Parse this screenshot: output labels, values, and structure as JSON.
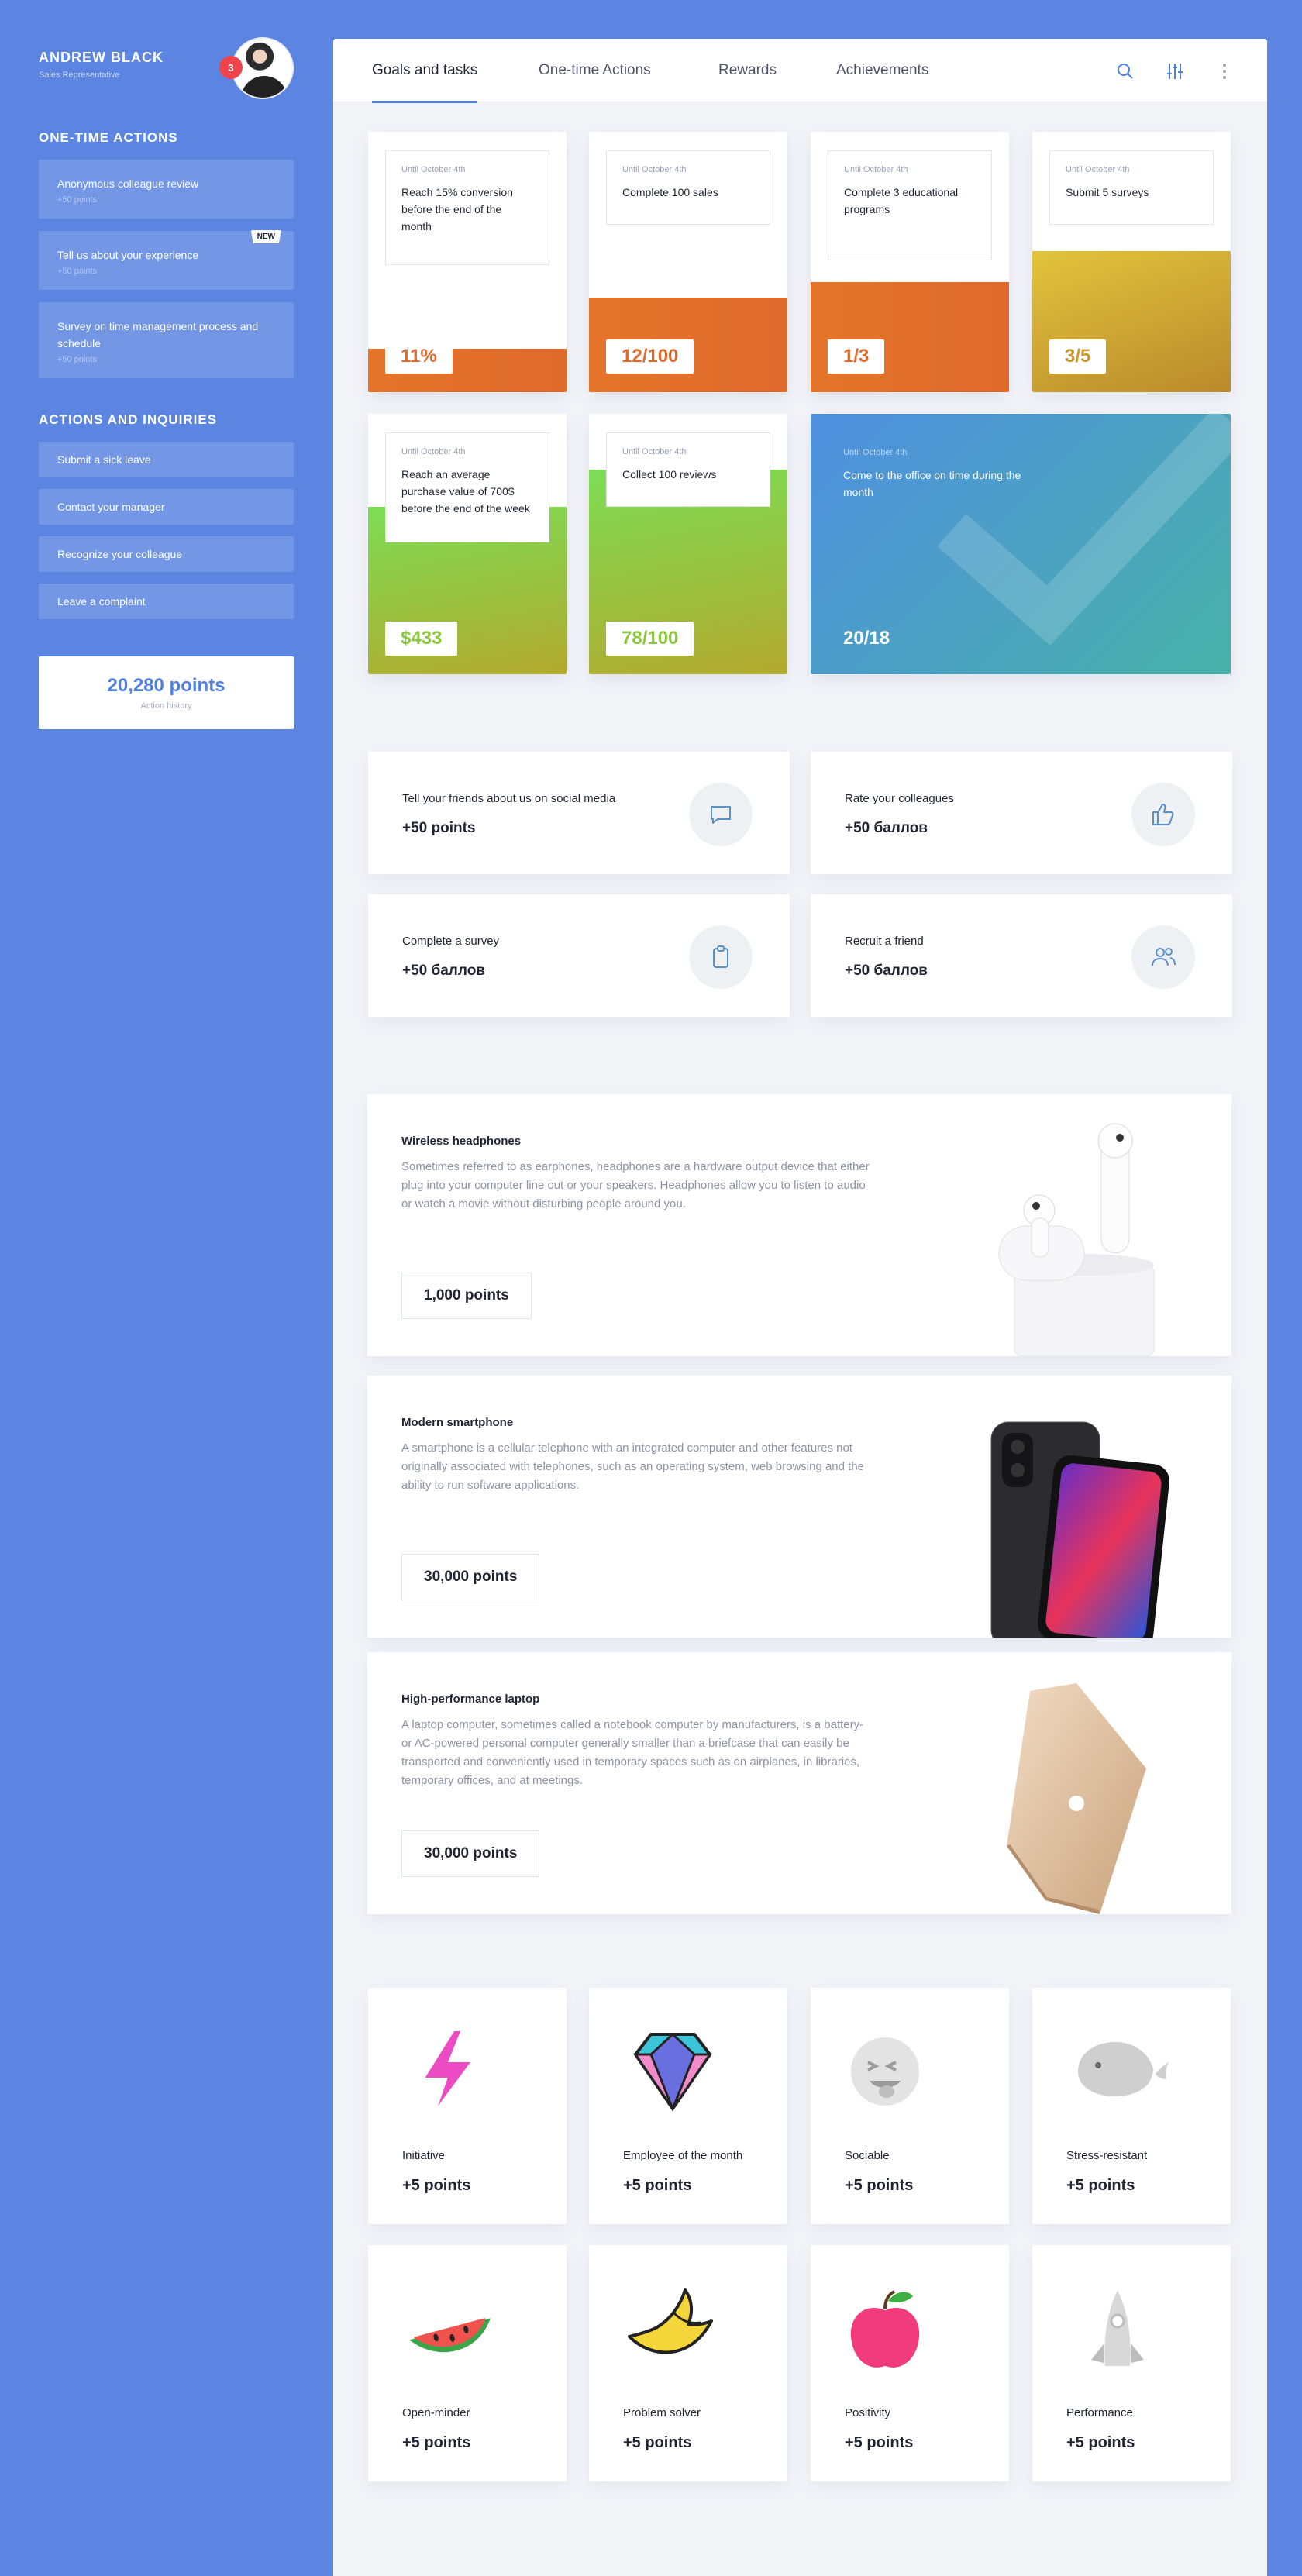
{
  "profile": {
    "name": "ANDREW BLACK",
    "role": "Sales Representative",
    "notifications": "3"
  },
  "sidebar": {
    "one_time_title": "ONE-TIME ACTIONS",
    "one_time_items": [
      {
        "title": "Anonymous colleague review",
        "points": "+50 points"
      },
      {
        "title": "Tell us about your experience",
        "points": "+50 points",
        "badge": "NEW"
      },
      {
        "title": "Survey on time management process and schedule",
        "points": "+50 points"
      }
    ],
    "inquiries_title": "ACTIONS AND INQUIRIES",
    "inquiries": [
      "Submit a sick leave",
      "Contact your manager",
      "Recognize your colleague",
      "Leave a complaint"
    ],
    "points_total": "20,280 points",
    "action_history": "Action history"
  },
  "tabs": [
    "Goals and tasks",
    "One-time Actions",
    "Rewards",
    "Achievements"
  ],
  "tools": {
    "search": "search-icon",
    "filter": "sliders-icon",
    "more": "more-vertical-icon"
  },
  "goals": [
    {
      "until": "Until October 4th",
      "task": "Reach 15% conversion before the end of the month",
      "value": "11%",
      "progress": 0.11,
      "color": "#e06a2c"
    },
    {
      "until": "Until October 4th",
      "task": "Complete 100 sales",
      "value": "12/100",
      "progress": 0.12,
      "color": "#e06a2c"
    },
    {
      "until": "Until October 4th",
      "task": "Complete 3 educational programs",
      "value": "1/3",
      "progress": 0.33,
      "color": "#e06a2c"
    },
    {
      "until": "Until October 4th",
      "task": "Submit 5 surveys",
      "value": "3/5",
      "progress": 0.6,
      "color": "#c9972a"
    },
    {
      "until": "Until October 4th",
      "task": "Reach an average purchase value of 700$ before the end of the week",
      "value": "$433",
      "progress": 0.62,
      "color": "#8cc83c"
    },
    {
      "until": "Until October 4th",
      "task": "Collect 100 reviews",
      "value": "78/100",
      "progress": 0.78,
      "color": "#8cc83c"
    },
    {
      "until": "Until October 4th",
      "task": "Come to the office on time during the month",
      "value": "20/18",
      "progress": 1,
      "color": "#4a9ad6"
    }
  ],
  "actions": [
    {
      "title": "Tell your friends about us on social media",
      "points": "+50 points",
      "icon": "chat-icon"
    },
    {
      "title": "Rate your colleagues",
      "points": "+50 баллов",
      "icon": "thumbs-up-icon"
    },
    {
      "title": "Complete a survey",
      "points": "+50 баллов",
      "icon": "clipboard-icon"
    },
    {
      "title": "Recruit a friend",
      "points": "+50 баллов",
      "icon": "users-icon"
    }
  ],
  "rewards": [
    {
      "name": "Wireless headphones",
      "desc": "Sometimes referred to as earphones, headphones are a hardware output device that either plug into your computer line out or your speakers. Headphones allow you to listen to audio or watch a movie without disturbing people around you.",
      "price": "1,000 points",
      "image": "airpods-image"
    },
    {
      "name": "Modern smartphone",
      "desc": "A smartphone is a cellular telephone with an integrated computer and other features not originally associated with telephones, such as an operating system, web browsing and the ability to run software applications.",
      "price": "30,000 points",
      "image": "smartphone-image"
    },
    {
      "name": "High-performance laptop",
      "desc": "A laptop computer, sometimes called a notebook computer by manufacturers, is a battery- or AC-powered personal computer generally smaller than a briefcase that can easily be transported and conveniently used in temporary spaces such as on airplanes, in libraries, temporary offices, and at meetings.",
      "price": "30,000 points",
      "image": "laptop-image"
    }
  ],
  "achievements": [
    {
      "name": "Initiative",
      "points": "+5 points",
      "icon": "lightning-icon"
    },
    {
      "name": "Employee of the month",
      "points": "+5 points",
      "icon": "diamond-icon"
    },
    {
      "name": "Sociable",
      "points": "+5 points",
      "icon": "emoji-icon"
    },
    {
      "name": "Stress-resistant",
      "points": "+5 points",
      "icon": "whale-icon"
    },
    {
      "name": "Open-minder",
      "points": "+5 points",
      "icon": "watermelon-icon"
    },
    {
      "name": "Problem solver",
      "points": "+5 points",
      "icon": "banana-icon"
    },
    {
      "name": "Positivity",
      "points": "+5 points",
      "icon": "apple-icon"
    },
    {
      "name": "Performance",
      "points": "+5 points",
      "icon": "rocket-icon"
    }
  ]
}
